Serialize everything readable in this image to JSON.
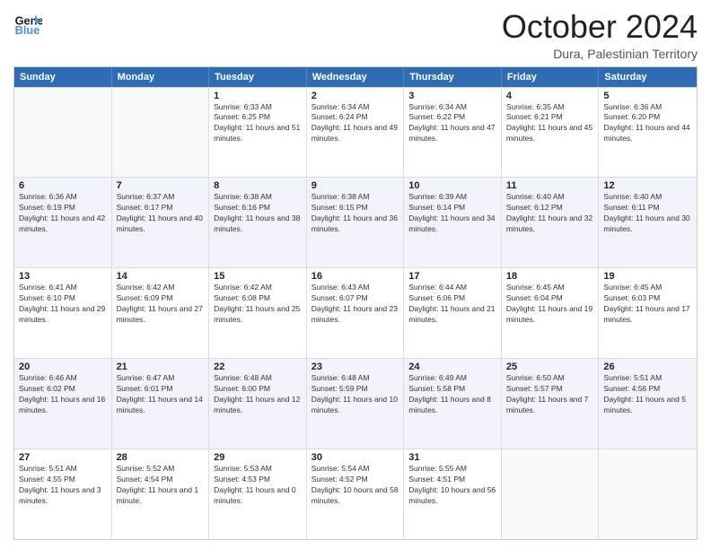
{
  "logo": {
    "text_general": "General",
    "text_blue": "Blue"
  },
  "header": {
    "month": "October 2024",
    "location": "Dura, Palestinian Territory"
  },
  "days_of_week": [
    "Sunday",
    "Monday",
    "Tuesday",
    "Wednesday",
    "Thursday",
    "Friday",
    "Saturday"
  ],
  "weeks": [
    [
      {
        "day": "",
        "sunrise": "",
        "sunset": "",
        "daylight": "",
        "empty": true
      },
      {
        "day": "",
        "sunrise": "",
        "sunset": "",
        "daylight": "",
        "empty": true
      },
      {
        "day": "1",
        "sunrise": "Sunrise: 6:33 AM",
        "sunset": "Sunset: 6:25 PM",
        "daylight": "Daylight: 11 hours and 51 minutes.",
        "empty": false
      },
      {
        "day": "2",
        "sunrise": "Sunrise: 6:34 AM",
        "sunset": "Sunset: 6:24 PM",
        "daylight": "Daylight: 11 hours and 49 minutes.",
        "empty": false
      },
      {
        "day": "3",
        "sunrise": "Sunrise: 6:34 AM",
        "sunset": "Sunset: 6:22 PM",
        "daylight": "Daylight: 11 hours and 47 minutes.",
        "empty": false
      },
      {
        "day": "4",
        "sunrise": "Sunrise: 6:35 AM",
        "sunset": "Sunset: 6:21 PM",
        "daylight": "Daylight: 11 hours and 45 minutes.",
        "empty": false
      },
      {
        "day": "5",
        "sunrise": "Sunrise: 6:36 AM",
        "sunset": "Sunset: 6:20 PM",
        "daylight": "Daylight: 11 hours and 44 minutes.",
        "empty": false
      }
    ],
    [
      {
        "day": "6",
        "sunrise": "Sunrise: 6:36 AM",
        "sunset": "Sunset: 6:19 PM",
        "daylight": "Daylight: 11 hours and 42 minutes.",
        "empty": false
      },
      {
        "day": "7",
        "sunrise": "Sunrise: 6:37 AM",
        "sunset": "Sunset: 6:17 PM",
        "daylight": "Daylight: 11 hours and 40 minutes.",
        "empty": false
      },
      {
        "day": "8",
        "sunrise": "Sunrise: 6:38 AM",
        "sunset": "Sunset: 6:16 PM",
        "daylight": "Daylight: 11 hours and 38 minutes.",
        "empty": false
      },
      {
        "day": "9",
        "sunrise": "Sunrise: 6:38 AM",
        "sunset": "Sunset: 6:15 PM",
        "daylight": "Daylight: 11 hours and 36 minutes.",
        "empty": false
      },
      {
        "day": "10",
        "sunrise": "Sunrise: 6:39 AM",
        "sunset": "Sunset: 6:14 PM",
        "daylight": "Daylight: 11 hours and 34 minutes.",
        "empty": false
      },
      {
        "day": "11",
        "sunrise": "Sunrise: 6:40 AM",
        "sunset": "Sunset: 6:12 PM",
        "daylight": "Daylight: 11 hours and 32 minutes.",
        "empty": false
      },
      {
        "day": "12",
        "sunrise": "Sunrise: 6:40 AM",
        "sunset": "Sunset: 6:11 PM",
        "daylight": "Daylight: 11 hours and 30 minutes.",
        "empty": false
      }
    ],
    [
      {
        "day": "13",
        "sunrise": "Sunrise: 6:41 AM",
        "sunset": "Sunset: 6:10 PM",
        "daylight": "Daylight: 11 hours and 29 minutes.",
        "empty": false
      },
      {
        "day": "14",
        "sunrise": "Sunrise: 6:42 AM",
        "sunset": "Sunset: 6:09 PM",
        "daylight": "Daylight: 11 hours and 27 minutes.",
        "empty": false
      },
      {
        "day": "15",
        "sunrise": "Sunrise: 6:42 AM",
        "sunset": "Sunset: 6:08 PM",
        "daylight": "Daylight: 11 hours and 25 minutes.",
        "empty": false
      },
      {
        "day": "16",
        "sunrise": "Sunrise: 6:43 AM",
        "sunset": "Sunset: 6:07 PM",
        "daylight": "Daylight: 11 hours and 23 minutes.",
        "empty": false
      },
      {
        "day": "17",
        "sunrise": "Sunrise: 6:44 AM",
        "sunset": "Sunset: 6:06 PM",
        "daylight": "Daylight: 11 hours and 21 minutes.",
        "empty": false
      },
      {
        "day": "18",
        "sunrise": "Sunrise: 6:45 AM",
        "sunset": "Sunset: 6:04 PM",
        "daylight": "Daylight: 11 hours and 19 minutes.",
        "empty": false
      },
      {
        "day": "19",
        "sunrise": "Sunrise: 6:45 AM",
        "sunset": "Sunset: 6:03 PM",
        "daylight": "Daylight: 11 hours and 17 minutes.",
        "empty": false
      }
    ],
    [
      {
        "day": "20",
        "sunrise": "Sunrise: 6:46 AM",
        "sunset": "Sunset: 6:02 PM",
        "daylight": "Daylight: 11 hours and 16 minutes.",
        "empty": false
      },
      {
        "day": "21",
        "sunrise": "Sunrise: 6:47 AM",
        "sunset": "Sunset: 6:01 PM",
        "daylight": "Daylight: 11 hours and 14 minutes.",
        "empty": false
      },
      {
        "day": "22",
        "sunrise": "Sunrise: 6:48 AM",
        "sunset": "Sunset: 6:00 PM",
        "daylight": "Daylight: 11 hours and 12 minutes.",
        "empty": false
      },
      {
        "day": "23",
        "sunrise": "Sunrise: 6:48 AM",
        "sunset": "Sunset: 5:59 PM",
        "daylight": "Daylight: 11 hours and 10 minutes.",
        "empty": false
      },
      {
        "day": "24",
        "sunrise": "Sunrise: 6:49 AM",
        "sunset": "Sunset: 5:58 PM",
        "daylight": "Daylight: 11 hours and 8 minutes.",
        "empty": false
      },
      {
        "day": "25",
        "sunrise": "Sunrise: 6:50 AM",
        "sunset": "Sunset: 5:57 PM",
        "daylight": "Daylight: 11 hours and 7 minutes.",
        "empty": false
      },
      {
        "day": "26",
        "sunrise": "Sunrise: 5:51 AM",
        "sunset": "Sunset: 4:56 PM",
        "daylight": "Daylight: 11 hours and 5 minutes.",
        "empty": false
      }
    ],
    [
      {
        "day": "27",
        "sunrise": "Sunrise: 5:51 AM",
        "sunset": "Sunset: 4:55 PM",
        "daylight": "Daylight: 11 hours and 3 minutes.",
        "empty": false
      },
      {
        "day": "28",
        "sunrise": "Sunrise: 5:52 AM",
        "sunset": "Sunset: 4:54 PM",
        "daylight": "Daylight: 11 hours and 1 minute.",
        "empty": false
      },
      {
        "day": "29",
        "sunrise": "Sunrise: 5:53 AM",
        "sunset": "Sunset: 4:53 PM",
        "daylight": "Daylight: 11 hours and 0 minutes.",
        "empty": false
      },
      {
        "day": "30",
        "sunrise": "Sunrise: 5:54 AM",
        "sunset": "Sunset: 4:52 PM",
        "daylight": "Daylight: 10 hours and 58 minutes.",
        "empty": false
      },
      {
        "day": "31",
        "sunrise": "Sunrise: 5:55 AM",
        "sunset": "Sunset: 4:51 PM",
        "daylight": "Daylight: 10 hours and 56 minutes.",
        "empty": false
      },
      {
        "day": "",
        "sunrise": "",
        "sunset": "",
        "daylight": "",
        "empty": true
      },
      {
        "day": "",
        "sunrise": "",
        "sunset": "",
        "daylight": "",
        "empty": true
      }
    ]
  ]
}
